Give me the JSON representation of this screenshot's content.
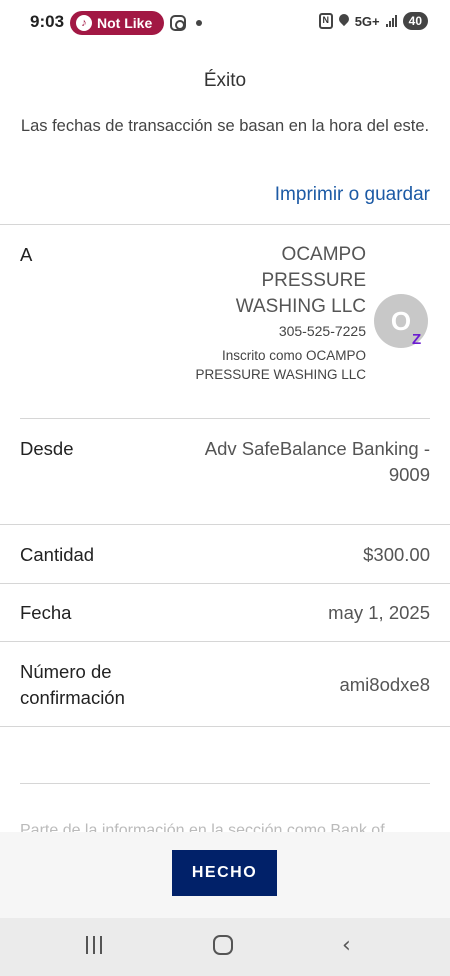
{
  "status_bar": {
    "time": "9:03",
    "notification_pill": "Not Like",
    "network": "5G+",
    "battery": "40"
  },
  "header": {
    "title": "Éxito"
  },
  "notice": "Las fechas de transacción se basan en la hora del este.",
  "print_link": "Imprimir o guardar",
  "details": {
    "to": {
      "label": "A",
      "name": "OCAMPO PRESSURE WASHING LLC",
      "phone": "305-525-7225",
      "enrolled": "Inscrito como OCAMPO PRESSURE WASHING LLC",
      "avatar_initial": "O",
      "badge": "Z"
    },
    "from": {
      "label": "Desde",
      "value": "Adv SafeBalance Banking - 9009"
    },
    "amount": {
      "label": "Cantidad",
      "value": "$300.00"
    },
    "date": {
      "label": "Fecha",
      "value": "may 1, 2025"
    },
    "confirmation": {
      "label": "Número de confirmación",
      "value": "ami8odxe8"
    }
  },
  "faded_text": "Parte de la información en la sección como Bank of",
  "footer": {
    "done_label": "HECHO"
  },
  "colors": {
    "link": "#1c5aa5",
    "button": "#012169",
    "pill": "#a21844",
    "zelle": "#6c1cd1"
  }
}
